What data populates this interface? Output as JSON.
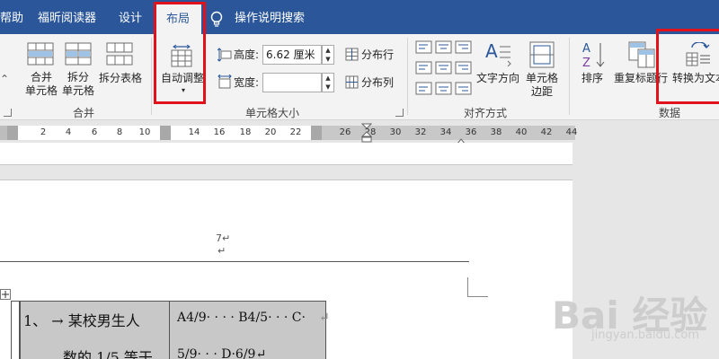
{
  "tabs": {
    "help": "帮助",
    "reader": "福昕阅读器",
    "design": "设计",
    "layout": "布局",
    "search": "操作说明搜索"
  },
  "ribbon": {
    "merge": {
      "merge_cells_1": "合并",
      "merge_cells_2": "单元格",
      "split_cells_1": "拆分",
      "split_cells_2": "单元格",
      "split_table": "拆分表格",
      "group_label": "合并"
    },
    "cell_size": {
      "autofit": "自动调整",
      "height_label": "高度:",
      "height_value": "6.62 厘米",
      "width_label": "宽度:",
      "width_value": "",
      "distribute_rows": "分布行",
      "distribute_cols": "分布列",
      "group_label": "单元格大小"
    },
    "alignment": {
      "text_direction": "文字方向",
      "cell_margins_1": "单元格",
      "cell_margins_2": "边距",
      "group_label": "对齐方式"
    },
    "data": {
      "sort": "排序",
      "repeat_header": "重复标题行",
      "convert_to_text": "转换为文本",
      "group_label": "数据"
    }
  },
  "ruler": {
    "ticks_a": [
      "2",
      "4",
      "6",
      "8",
      "10"
    ],
    "ticks_b": [
      "14",
      "16",
      "18",
      "20",
      "22"
    ],
    "ticks_c": [
      "26",
      "28",
      "30",
      "32",
      "34",
      "36",
      "38",
      "40",
      "42",
      "44"
    ]
  },
  "document": {
    "page_number": "7↵",
    "para_mark": "↵",
    "cell1_line1": "1、 → 某校男生人",
    "cell1_line2": "数的 1/5 等于",
    "cell2_line1": "A4/9· · · · B4/5· · · C·",
    "cell2_line2": "5/9· · · D·6/9↵",
    "end_mark": "↵"
  },
  "watermark": {
    "brand": "Bai 经验",
    "url": "jingyan.baidu.com"
  }
}
